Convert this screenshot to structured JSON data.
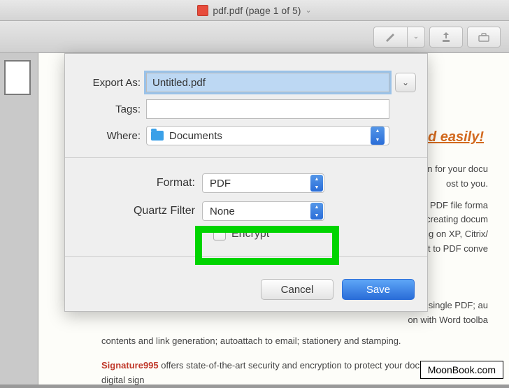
{
  "window": {
    "title": "pdf.pdf (page 1 of 5)"
  },
  "background": {
    "heading": "d easily!",
    "para1a": "olution for your docu",
    "para1b": "ost to you.",
    "para2a": "opular PDF file forma",
    "para2b": "ion, creating docum",
    "para2c": "ching on XP, Citrix/",
    "para2d": "script to PDF conve",
    "para3a": "to a single PDF; au",
    "para3b": "on with Word toolba",
    "para4": "contents and link generation; autoattach to email; stationery and stamping.",
    "sig_label": "Signature995",
    "sig_rest": " offers state-of-the-art security and encryption to protect your documents and add digital sign"
  },
  "dialog": {
    "export_as_label": "Export As:",
    "export_as_value": "Untitled.pdf",
    "tags_label": "Tags:",
    "tags_value": "",
    "where_label": "Where:",
    "where_value": "Documents",
    "format_label": "Format:",
    "format_value": "PDF",
    "quartz_label": "Quartz Filter",
    "quartz_value": "None",
    "encrypt_label": "Encrypt",
    "cancel": "Cancel",
    "save": "Save"
  },
  "watermark": "MoonBook.com"
}
